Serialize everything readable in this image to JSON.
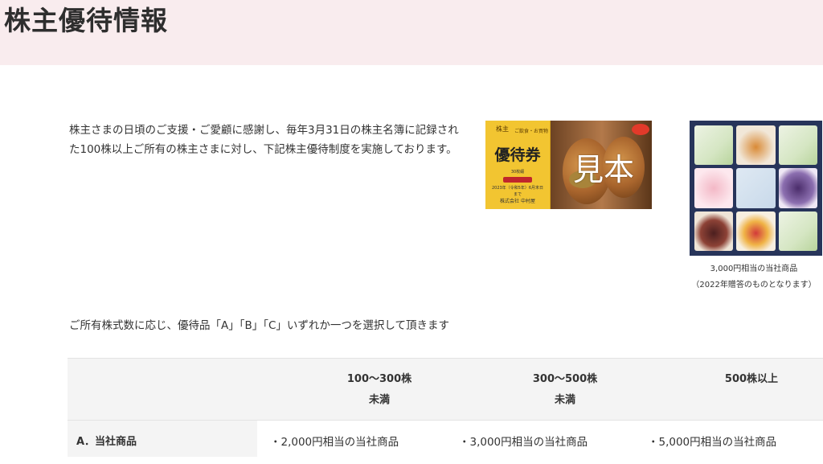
{
  "header": {
    "title": "株主優待情報"
  },
  "intro": {
    "text": "株主さまの日頃のご支援・ご愛顧に感謝し、毎年3月31日の株主名簿に記録された100株以上ご所有の株主さまに対し、下記株主優待制度を実施しております。"
  },
  "voucher_image": {
    "corner_label": "株主",
    "sub_label": "ご飲食・お買物",
    "name": "優待券",
    "small_text": "30枚綴",
    "date_text": "2023年（令和5年）6月末日まで",
    "company": "株式会社 中村屋",
    "watermark": "見本"
  },
  "gift_image": {
    "caption_line1": "3,000円相当の当社商品",
    "caption_line2": "（2022年贈答のものとなります）"
  },
  "selection": {
    "text": "ご所有株式数に応じ、優待品「A」「B」「C」いずれか一つを選択して頂きます"
  },
  "table": {
    "headers": [
      {
        "line1": "100〜300株",
        "line2": "未満"
      },
      {
        "line1": "300〜500株",
        "line2": "未満"
      },
      {
        "line1": "500株以上",
        "line2": ""
      }
    ],
    "rows": [
      {
        "label": "A．当社商品",
        "cells": [
          "・2,000円相当の当社商品",
          "・3,000円相当の当社商品",
          "・5,000円相当の当社商品"
        ]
      }
    ]
  },
  "colors": {
    "title_band": "#f9ecee",
    "table_header_bg": "#f4f4f4",
    "voucher_yellow": "#f2c531",
    "gift_box_frame": "#27345a"
  }
}
